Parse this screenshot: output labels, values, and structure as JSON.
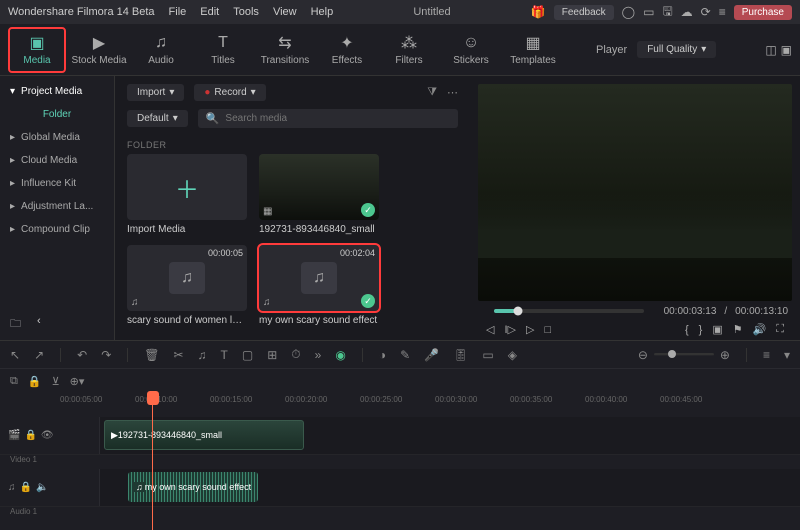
{
  "header": {
    "app_name": "Wondershare Filmora 14 Beta",
    "menus": [
      "File",
      "Edit",
      "Tools",
      "View",
      "Help"
    ],
    "filename": "Untitled",
    "feedback": "Feedback",
    "purchase": "Purchase"
  },
  "tools": [
    {
      "label": "Media",
      "icon": "image"
    },
    {
      "label": "Stock Media",
      "icon": "video"
    },
    {
      "label": "Audio",
      "icon": "note"
    },
    {
      "label": "Titles",
      "icon": "T"
    },
    {
      "label": "Transitions",
      "icon": "trans"
    },
    {
      "label": "Effects",
      "icon": "fx"
    },
    {
      "label": "Filters",
      "icon": "filters"
    },
    {
      "label": "Stickers",
      "icon": "sticker"
    },
    {
      "label": "Templates",
      "icon": "tpl"
    }
  ],
  "player": {
    "label": "Player",
    "quality": "Full Quality"
  },
  "sidebar": {
    "items": [
      {
        "label": "Project Media",
        "active": true
      },
      {
        "label": "Global Media"
      },
      {
        "label": "Cloud Media"
      },
      {
        "label": "Influence Kit"
      },
      {
        "label": "Adjustment La..."
      },
      {
        "label": "Compound Clip"
      }
    ],
    "folder": "Folder"
  },
  "library": {
    "import": "Import",
    "record": "Record",
    "default": "Default",
    "search_ph": "Search media",
    "folder_label": "FOLDER",
    "cards": [
      {
        "title": "Import Media",
        "type": "plus"
      },
      {
        "title": "192731-893446840_small",
        "type": "video"
      },
      {
        "title": "scary sound of women laug...",
        "type": "audio",
        "dur": "00:00:05"
      },
      {
        "title": "my own scary sound effect",
        "type": "audio",
        "dur": "00:02:04",
        "selected": true
      }
    ]
  },
  "preview": {
    "current": "00:00:03:13",
    "total": "00:00:13:10"
  },
  "timeline": {
    "ticks": [
      "00:00:05:00",
      "00:00:10:00",
      "00:00:15:00",
      "00:00:20:00",
      "00:00:25:00",
      "00:00:30:00",
      "00:00:35:00",
      "00:00:40:00",
      "00:00:45:00"
    ],
    "tracks": [
      {
        "name": "Video 1",
        "type": "video",
        "clip_label": "192731-893446840_small"
      },
      {
        "name": "Audio 1",
        "type": "audio",
        "clip_label": "my own scary sound effect"
      }
    ]
  }
}
